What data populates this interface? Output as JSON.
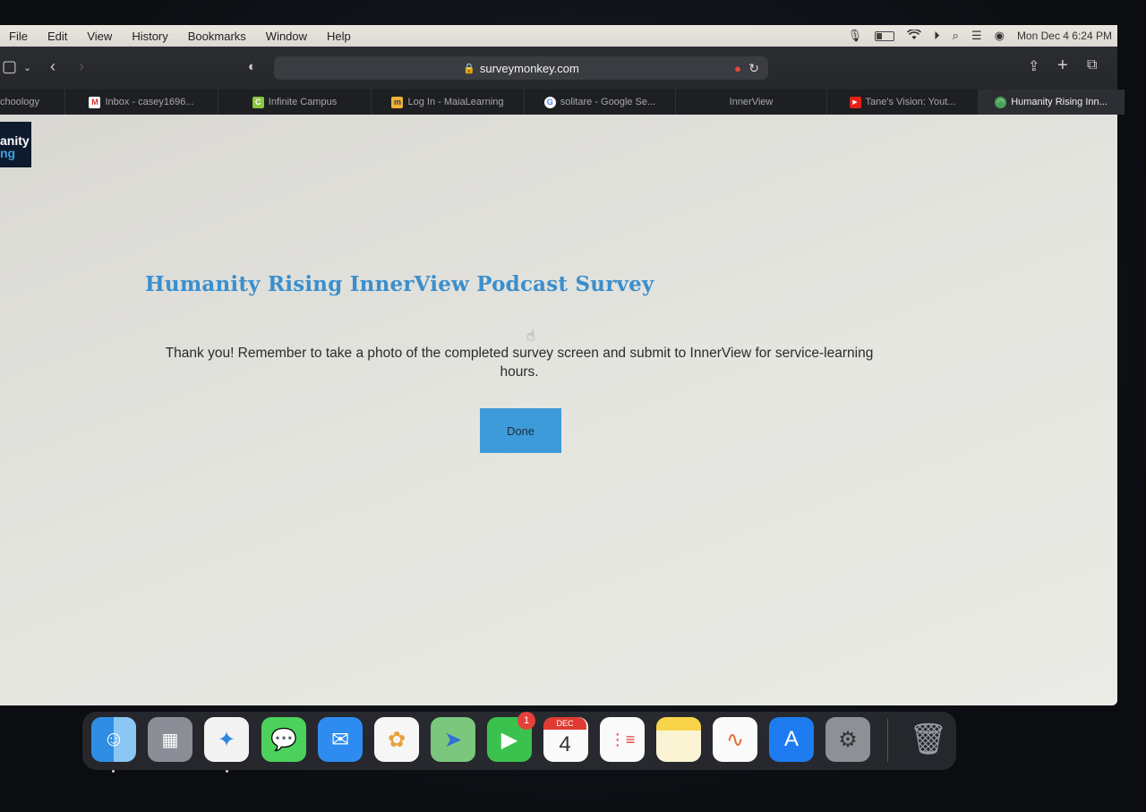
{
  "menubar": {
    "items": [
      "File",
      "Edit",
      "View",
      "History",
      "Bookmarks",
      "Window",
      "Help"
    ],
    "datetime": "Mon Dec 4  6:24 PM"
  },
  "toolbar": {
    "url": "surveymonkey.com"
  },
  "tabs": [
    {
      "label": "choology",
      "icon": "schoology-icon"
    },
    {
      "label": "Inbox - casey1696...",
      "icon": "gmail-icon"
    },
    {
      "label": "Infinite Campus",
      "icon": "infinite-campus-icon"
    },
    {
      "label": "Log In - MaiaLearning",
      "icon": "maialearning-icon"
    },
    {
      "label": "solitare - Google Se...",
      "icon": "google-icon"
    },
    {
      "label": "InnerView",
      "icon": ""
    },
    {
      "label": "Tane's Vision: Yout...",
      "icon": "youtube-icon"
    },
    {
      "label": "Humanity Rising Inn...",
      "icon": "humanity-rising-icon",
      "active": true
    }
  ],
  "page": {
    "logo_line1": "anity",
    "logo_line2": "ng",
    "title": "Humanity Rising InnerView Podcast Survey",
    "message": "Thank you! Remember to take a photo of the completed survey screen and submit to InnerView for service-learning hours.",
    "done_label": "Done"
  },
  "dock": {
    "apps": [
      "Finder",
      "Launchpad",
      "Safari",
      "Messages",
      "Mail",
      "Photos",
      "Maps",
      "FaceTime",
      "Calendar",
      "Reminders",
      "Notes",
      "Freeform",
      "App Store",
      "System Settings",
      "Trash"
    ],
    "facetime_badge": "1",
    "calendar_month": "DEC",
    "calendar_day": "4"
  },
  "colors": {
    "title": "#3b8fcd",
    "button": "#3e9bd9",
    "page_background": "#e5e5e0"
  }
}
